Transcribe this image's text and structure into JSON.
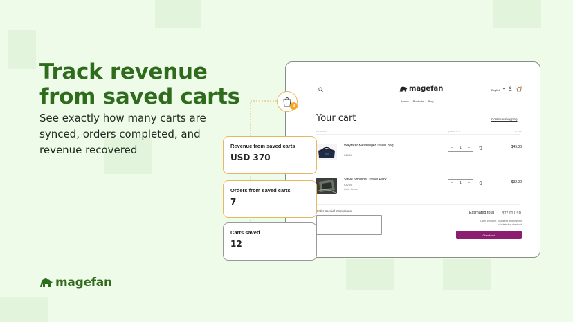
{
  "hero": {
    "headline": "Track revenue from saved carts",
    "subline": "See exactly how many carts are synced, orders completed, and revenue recovered"
  },
  "brand": {
    "name": "magefan",
    "color": "#2f6b1c"
  },
  "shop": {
    "logo_text": "magefan",
    "language": "English",
    "nav": [
      "Home",
      "Products",
      "Blog"
    ],
    "cart_title": "Your cart",
    "continue_link": "Continue shopping",
    "columns": {
      "product": "PRODUCT",
      "quantity": "QUANTITY",
      "total": "TOTAL"
    },
    "items": [
      {
        "name": "Wayfarer Messenger Travel Bag",
        "price": "$49.00",
        "variant": "",
        "qty": "1",
        "total": "$49.00"
      },
      {
        "name": "Strive Shoulder Travel Pack",
        "price": "$32.00",
        "variant": "Color: Brown",
        "qty": "1",
        "total": "$32.00"
      }
    ],
    "instructions_label": "Order special instructions",
    "estimated_label": "Estimated total",
    "estimated_value": "$77.00 USD",
    "tax_note": "Taxes included. Discounts and shipping calculated at checkout.",
    "checkout_label": "Check out",
    "checkout_color": "#8b1e6f"
  },
  "badge": {
    "count": "2",
    "icon": "shopping-bag-icon"
  },
  "stats": [
    {
      "label": "Revenue from saved carts",
      "value": "USD 370"
    },
    {
      "label": "Orders from saved carts",
      "value": "7"
    },
    {
      "label": "Carts saved",
      "value": "12"
    }
  ]
}
